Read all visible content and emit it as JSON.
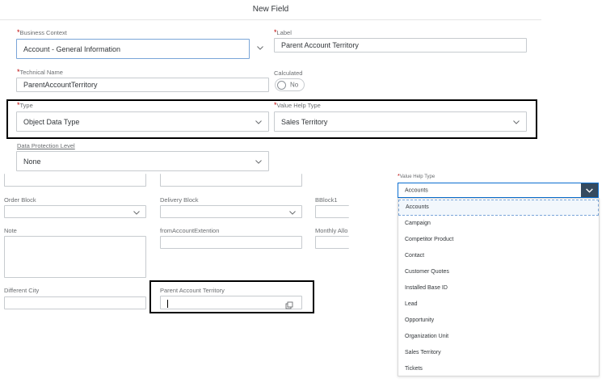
{
  "dialog": {
    "title": "New Field"
  },
  "form": {
    "business_context": {
      "label": "Business Context",
      "value": "Account - General Information"
    },
    "label_field": {
      "label": "Label",
      "value": "Parent Account Territory"
    },
    "technical_name": {
      "label": "Technical Name",
      "value": "ParentAccountTerritory"
    },
    "calculated": {
      "label": "Calculated",
      "toggle_text": "No"
    },
    "type": {
      "label": "Type",
      "value": "Object Data Type"
    },
    "value_help_type": {
      "label": "Value Help Type",
      "value": "Sales Territory"
    },
    "data_protection": {
      "label": "Data Protection Level",
      "value": "None"
    }
  },
  "background_form": {
    "order_block": {
      "label": "Order Block"
    },
    "delivery_block": {
      "label": "Delivery Block"
    },
    "bblock1": {
      "label": "BBlock1"
    },
    "note": {
      "label": "Note"
    },
    "from_account_extention": {
      "label": "fromAccountExtention"
    },
    "monthly_allo": {
      "label": "Monthly Allo"
    },
    "different_city": {
      "label": "Different City"
    },
    "parent_account_territory": {
      "label": "Parent Account Territory"
    }
  },
  "value_help_popup": {
    "label": "Value Help Type",
    "selected": "Accounts",
    "options": [
      "Accounts",
      "Campaign",
      "Competitor Product",
      "Contact",
      "Customer Quotes",
      "Installed Base ID",
      "Lead",
      "Opportunity",
      "Organization Unit",
      "Sales Territory",
      "Tickets"
    ]
  },
  "required_marker": "*",
  "icons": {
    "dropdown": "chevron-down-icon",
    "value_help": "copy-icon"
  },
  "colors": {
    "required": "#bb0000",
    "accent": "#0a6ed1",
    "dropdown_button": "#354a5f"
  }
}
